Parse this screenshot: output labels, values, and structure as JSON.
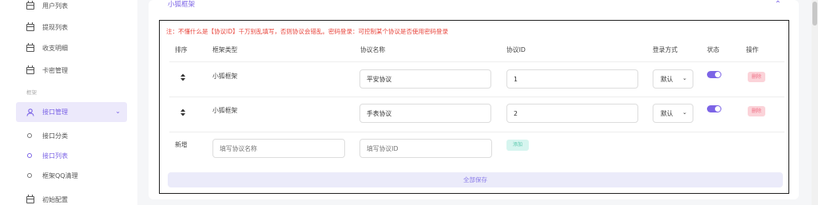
{
  "sidebar": {
    "items_top": [
      {
        "label": "用户列表",
        "icon": "calendar-icon"
      },
      {
        "label": "提现列表",
        "icon": "calendar-icon"
      },
      {
        "label": "收支明细",
        "icon": "calendar-icon"
      },
      {
        "label": "卡密管理",
        "icon": "calendar-icon"
      }
    ],
    "section_label": "框架",
    "active_item": {
      "label": "接口管理",
      "icon": "user-icon"
    },
    "sub_items": [
      {
        "label": "接口分类"
      },
      {
        "label": "接口列表"
      },
      {
        "label": "框架QQ清理"
      }
    ],
    "items_bottom": [
      {
        "label": "初始配置",
        "icon": "calendar-icon"
      }
    ]
  },
  "card": {
    "title": "小狐框架",
    "warning": "注：不懂什么是【协议ID】千万别乱填写，否则协议会错乱。密码登录：可控制某个协议是否使用密码登录",
    "headers": {
      "sort": "排序",
      "frame_type": "框架类型",
      "protocol_name": "协议名称",
      "protocol_id": "协议ID",
      "login_method": "登录方式",
      "status": "状态",
      "actions": "操作"
    },
    "rows": [
      {
        "frame_type": "小狐框架",
        "protocol_name": "平安协议",
        "protocol_id": "1",
        "login_method": "默认",
        "status_on": true,
        "delete_label": "删除"
      },
      {
        "frame_type": "小狐框架",
        "protocol_name": "手表协议",
        "protocol_id": "2",
        "login_method": "默认",
        "status_on": true,
        "delete_label": "删除"
      }
    ],
    "new_row": {
      "label": "新增",
      "name_placeholder": "填写协议名称",
      "id_placeholder": "填写协议ID",
      "add_label": "添加"
    },
    "save_all_label": "全部保存"
  },
  "colors": {
    "accent": "#7c64e6",
    "warning": "#e8453c",
    "delete": "#f07186",
    "add": "#5bc8ad"
  }
}
